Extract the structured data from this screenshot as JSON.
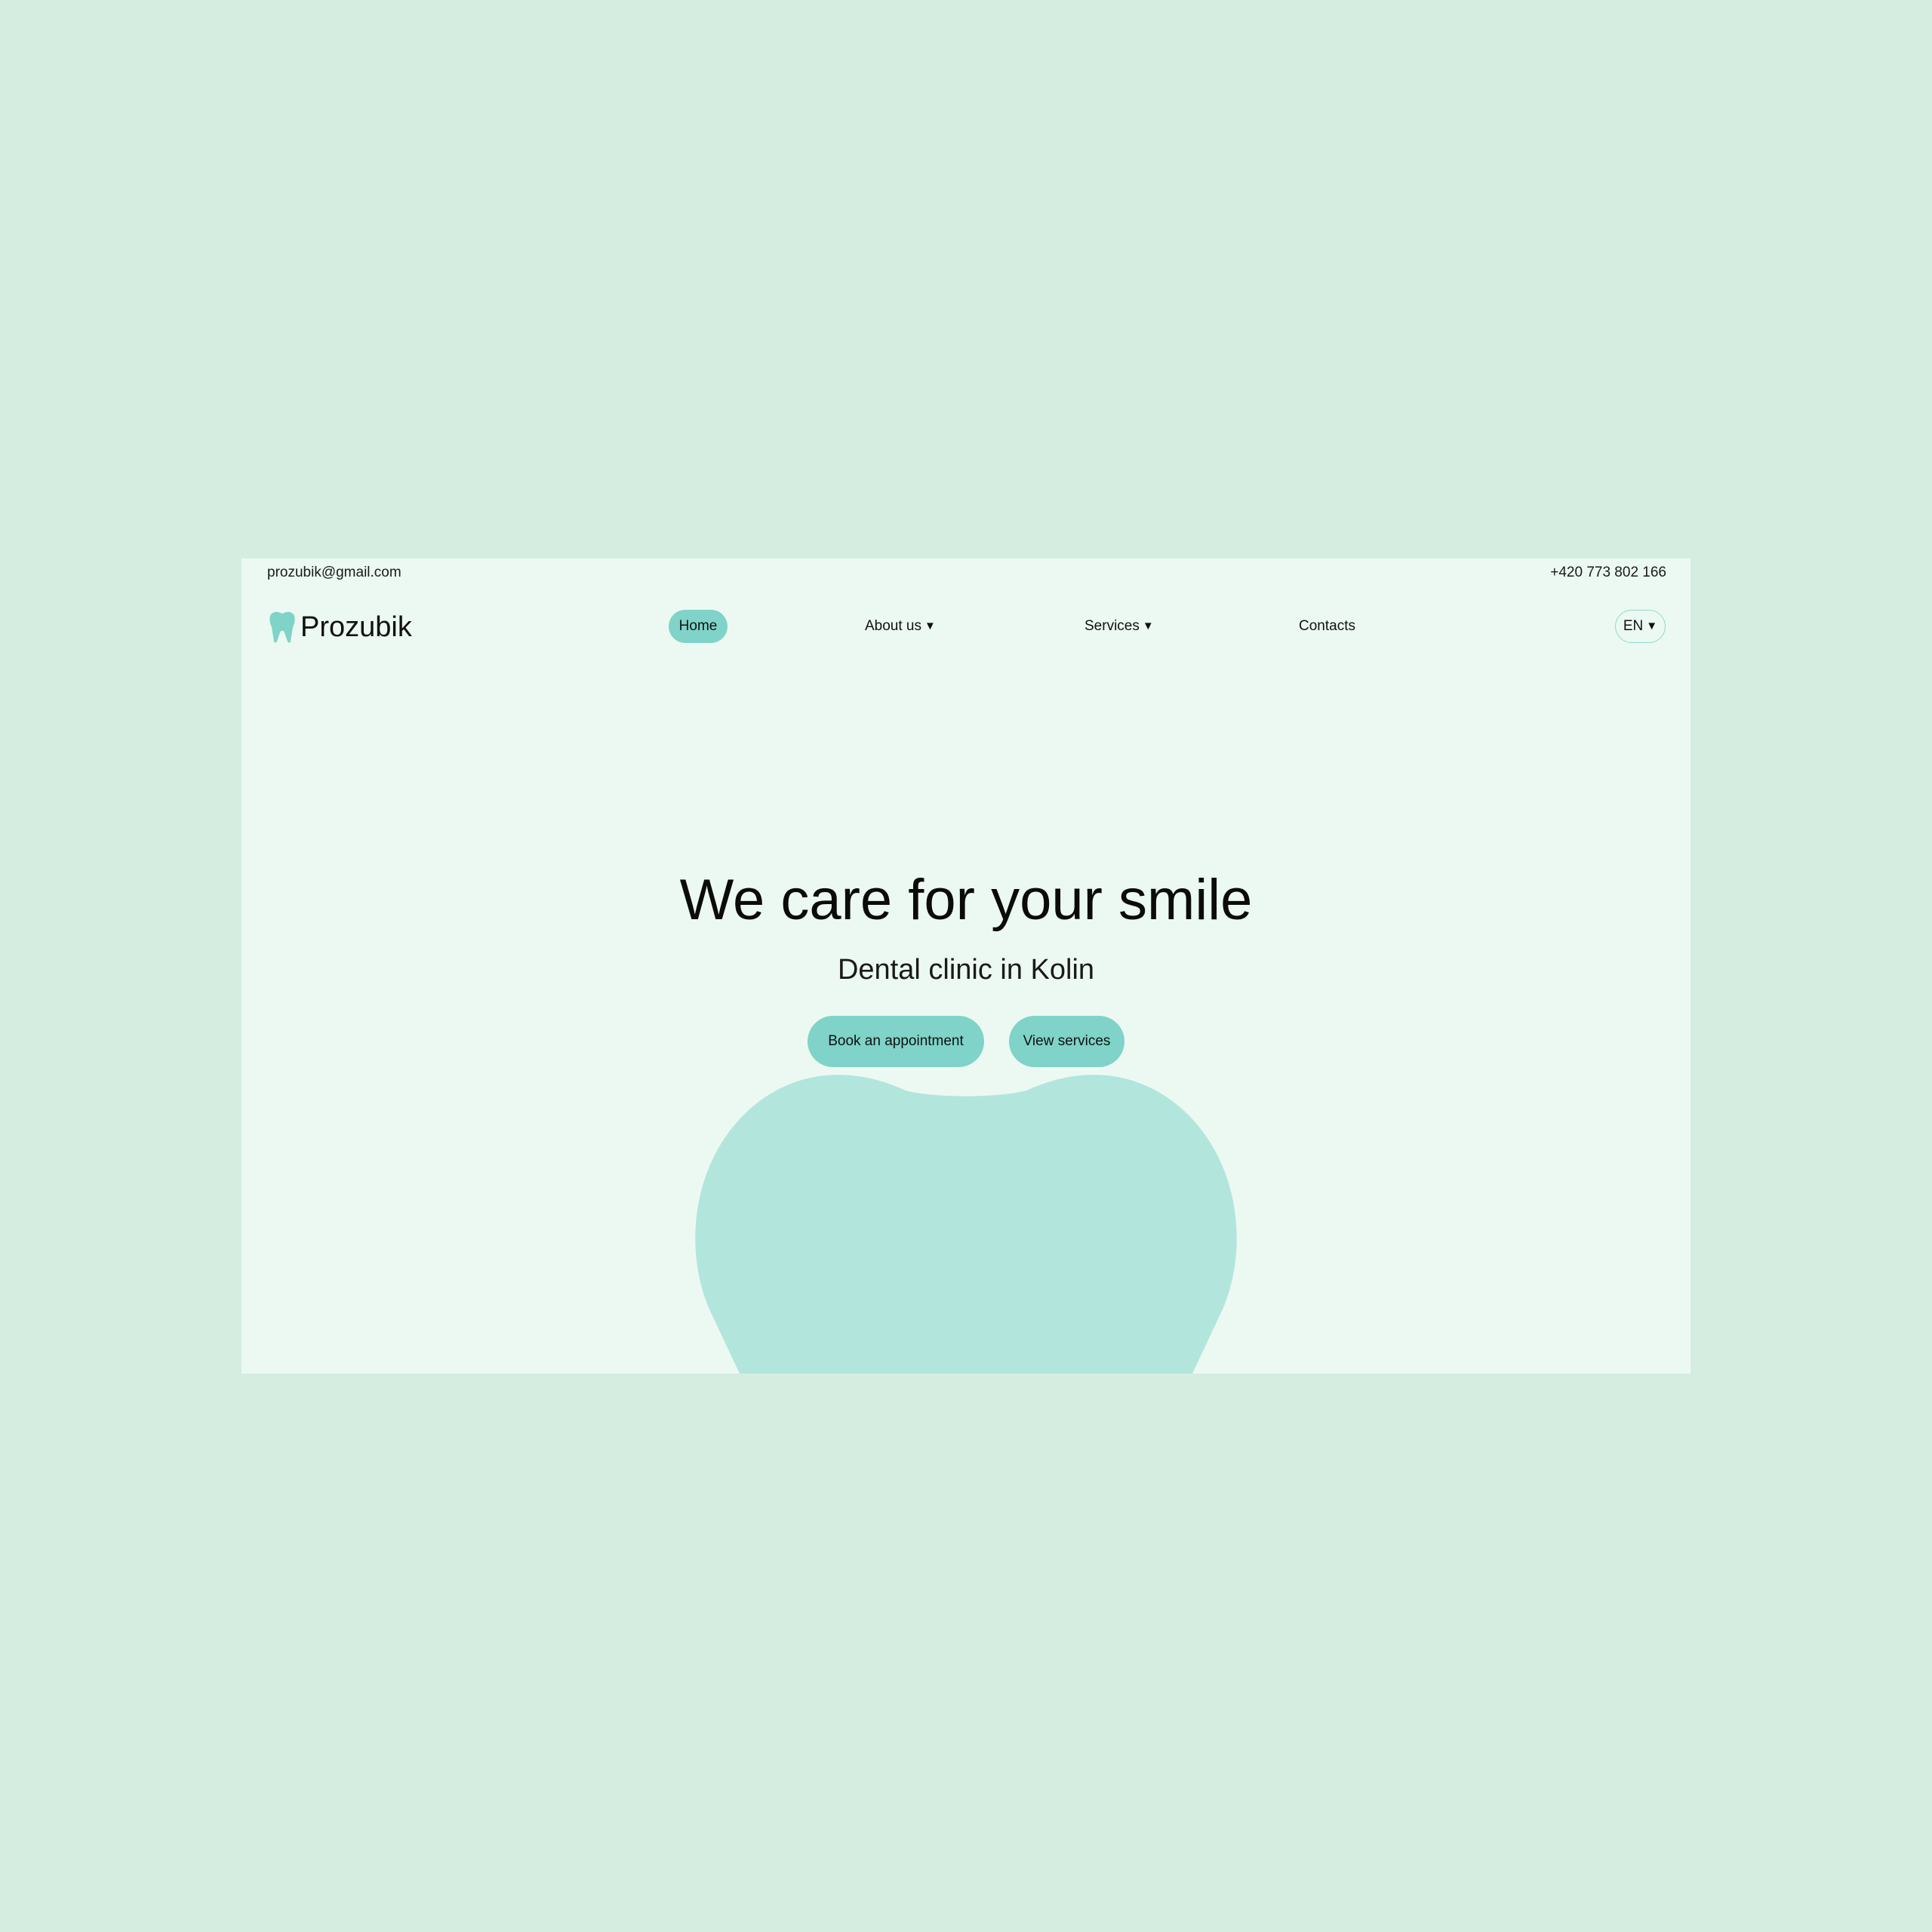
{
  "topbar": {
    "email": "prozubik@gmail.com",
    "phone": "+420 773 802 166"
  },
  "brand": {
    "name": "Prozubik",
    "icon": "tooth-icon"
  },
  "nav": {
    "items": [
      {
        "label": "Home",
        "active": true
      },
      {
        "label": "About us",
        "has_dropdown": true
      },
      {
        "label": "Services",
        "has_dropdown": true
      },
      {
        "label": "Contacts"
      }
    ],
    "dropdown_glyph": "▼"
  },
  "language": {
    "selected": "EN"
  },
  "hero": {
    "title": "We care for your smile",
    "subtitle": "Dental clinic in Kolin",
    "buttons": {
      "book": "Book an appointment",
      "services": "View services"
    }
  },
  "colors": {
    "backdrop": "#d5ede1",
    "page_background": "#ecf9f2",
    "accent": "#7fd3c8",
    "tooth_shape": "#b2e6dd"
  }
}
